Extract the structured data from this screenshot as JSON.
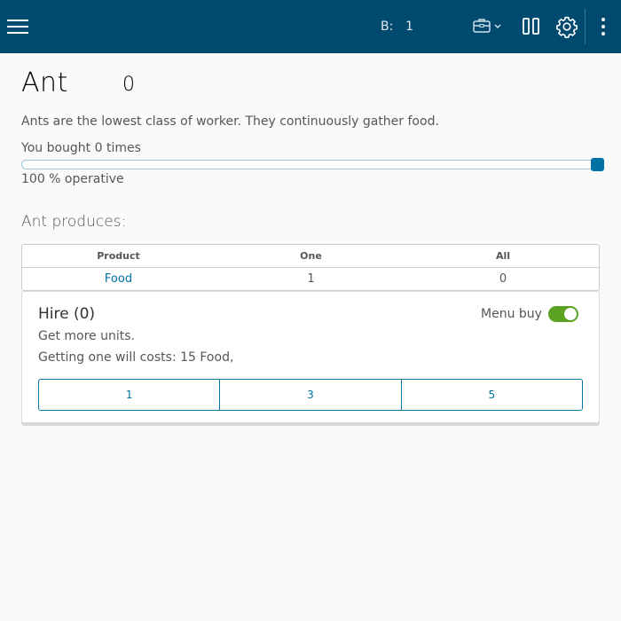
{
  "header": {
    "b_label": "B:",
    "b_value": "1",
    "icons": [
      "menu-icon",
      "toolbox-icon",
      "columns-icon",
      "gear-icon",
      "more-vertical-icon"
    ],
    "bg_color": "#004a70"
  },
  "unit": {
    "name": "Ant",
    "count": "0",
    "description": "Ants are the lowest class of worker. They continuously gather food.",
    "bought_text": "You bought 0 times",
    "operative_text": "100 % operative",
    "operative_fraction": 1.0
  },
  "produces": {
    "heading": "Ant produces:",
    "columns": [
      "Product",
      "One",
      "All"
    ],
    "rows": [
      {
        "product": "Food",
        "one": "1",
        "all": "0"
      }
    ]
  },
  "hire": {
    "title": "Hire (0)",
    "menu_buy_label": "Menu buy",
    "menu_buy_on": true,
    "line1": "Get more units.",
    "line2": "Getting one will costs: 15 Food,",
    "buttons": [
      "1",
      "3",
      "5"
    ]
  },
  "colors": {
    "accent": "#0072a3",
    "toggle_on": "#5aa220"
  }
}
